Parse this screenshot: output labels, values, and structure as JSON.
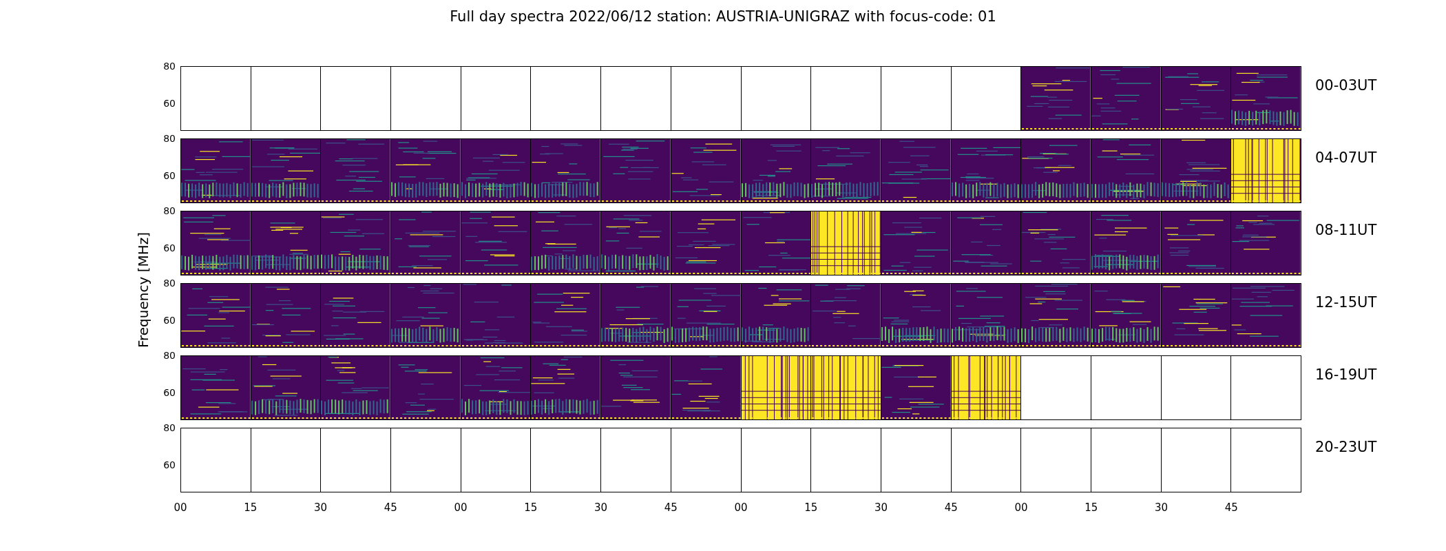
{
  "title": "Full day spectra 2022/06/12 station: AUSTRIA-UNIGRAZ with focus-code: 01",
  "ylabel": "Frequency [MHz]",
  "rows": [
    {
      "label": "00-03UT",
      "yticks": [
        "80",
        "60"
      ],
      "cells": [
        {
          "kind": "blank"
        },
        {
          "kind": "blank"
        },
        {
          "kind": "blank"
        },
        {
          "kind": "blank"
        },
        {
          "kind": "blank"
        },
        {
          "kind": "blank"
        },
        {
          "kind": "blank"
        },
        {
          "kind": "blank"
        },
        {
          "kind": "blank"
        },
        {
          "kind": "blank"
        },
        {
          "kind": "blank"
        },
        {
          "kind": "blank"
        },
        {
          "kind": "spectrum"
        },
        {
          "kind": "spectrum"
        },
        {
          "kind": "spectrum"
        },
        {
          "kind": "spectrum"
        }
      ]
    },
    {
      "label": "04-07UT",
      "yticks": [
        "80",
        "60"
      ],
      "cells": [
        {
          "kind": "spectrum"
        },
        {
          "kind": "spectrum"
        },
        {
          "kind": "spectrum"
        },
        {
          "kind": "spectrum"
        },
        {
          "kind": "spectrum"
        },
        {
          "kind": "spectrum"
        },
        {
          "kind": "spectrum"
        },
        {
          "kind": "spectrum"
        },
        {
          "kind": "spectrum"
        },
        {
          "kind": "spectrum"
        },
        {
          "kind": "spectrum"
        },
        {
          "kind": "spectrum"
        },
        {
          "kind": "spectrum"
        },
        {
          "kind": "spectrum"
        },
        {
          "kind": "spectrum"
        },
        {
          "kind": "burst"
        }
      ]
    },
    {
      "label": "08-11UT",
      "yticks": [
        "80",
        "60"
      ],
      "cells": [
        {
          "kind": "spectrum"
        },
        {
          "kind": "spectrum"
        },
        {
          "kind": "spectrum"
        },
        {
          "kind": "spectrum"
        },
        {
          "kind": "spectrum"
        },
        {
          "kind": "spectrum"
        },
        {
          "kind": "spectrum"
        },
        {
          "kind": "spectrum"
        },
        {
          "kind": "spectrum"
        },
        {
          "kind": "burst"
        },
        {
          "kind": "spectrum"
        },
        {
          "kind": "spectrum"
        },
        {
          "kind": "spectrum"
        },
        {
          "kind": "spectrum"
        },
        {
          "kind": "spectrum"
        },
        {
          "kind": "spectrum"
        }
      ]
    },
    {
      "label": "12-15UT",
      "yticks": [
        "80",
        "60"
      ],
      "cells": [
        {
          "kind": "spectrum"
        },
        {
          "kind": "spectrum"
        },
        {
          "kind": "spectrum"
        },
        {
          "kind": "spectrum"
        },
        {
          "kind": "spectrum"
        },
        {
          "kind": "spectrum"
        },
        {
          "kind": "spectrum"
        },
        {
          "kind": "spectrum"
        },
        {
          "kind": "spectrum"
        },
        {
          "kind": "spectrum"
        },
        {
          "kind": "spectrum"
        },
        {
          "kind": "spectrum"
        },
        {
          "kind": "spectrum"
        },
        {
          "kind": "spectrum"
        },
        {
          "kind": "spectrum"
        },
        {
          "kind": "spectrum"
        }
      ]
    },
    {
      "label": "16-19UT",
      "yticks": [
        "80",
        "60"
      ],
      "cells": [
        {
          "kind": "spectrum"
        },
        {
          "kind": "spectrum"
        },
        {
          "kind": "spectrum"
        },
        {
          "kind": "spectrum"
        },
        {
          "kind": "spectrum"
        },
        {
          "kind": "spectrum"
        },
        {
          "kind": "spectrum"
        },
        {
          "kind": "spectrum"
        },
        {
          "kind": "burst"
        },
        {
          "kind": "burst"
        },
        {
          "kind": "spectrum"
        },
        {
          "kind": "burst"
        },
        {
          "kind": "blank"
        },
        {
          "kind": "blank"
        },
        {
          "kind": "blank"
        },
        {
          "kind": "blank"
        }
      ]
    },
    {
      "label": "20-23UT",
      "yticks": [
        "80",
        "60"
      ],
      "cells": [
        {
          "kind": "blank"
        },
        {
          "kind": "blank"
        },
        {
          "kind": "blank"
        },
        {
          "kind": "blank"
        },
        {
          "kind": "blank"
        },
        {
          "kind": "blank"
        },
        {
          "kind": "blank"
        },
        {
          "kind": "blank"
        },
        {
          "kind": "blank"
        },
        {
          "kind": "blank"
        },
        {
          "kind": "blank"
        },
        {
          "kind": "blank"
        },
        {
          "kind": "blank"
        },
        {
          "kind": "blank"
        },
        {
          "kind": "blank"
        },
        {
          "kind": "blank"
        }
      ]
    }
  ],
  "xticks": [
    "00",
    "15",
    "30",
    "45",
    "00",
    "15",
    "30",
    "45",
    "00",
    "15",
    "30",
    "45",
    "00",
    "15",
    "30",
    "45"
  ]
}
